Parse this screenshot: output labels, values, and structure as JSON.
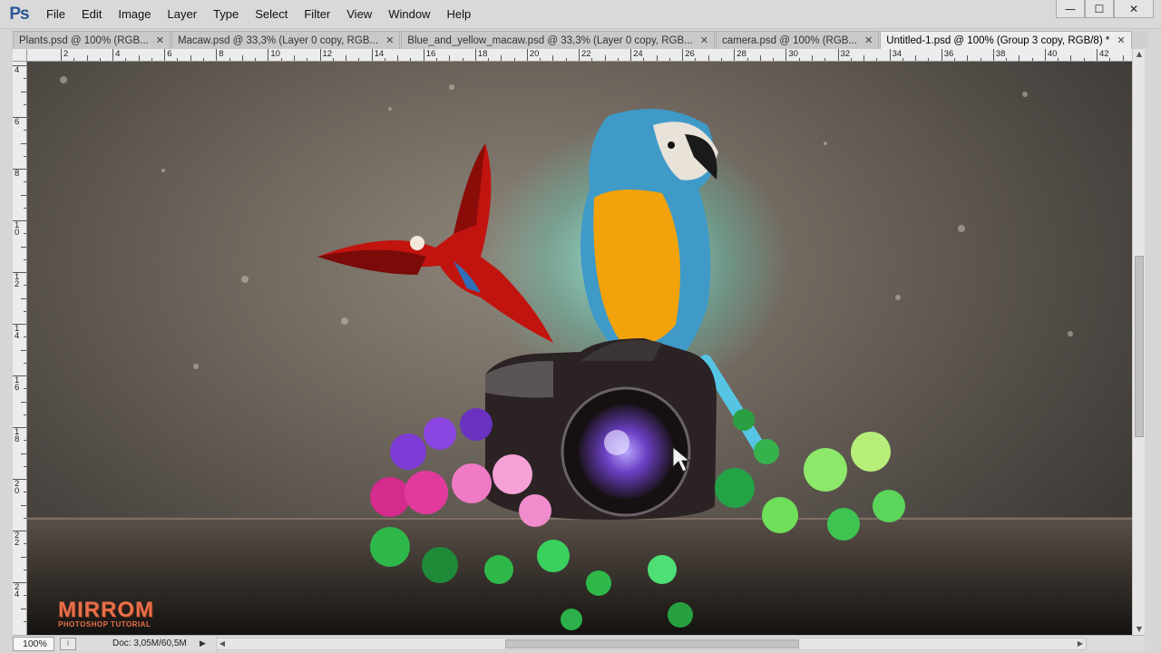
{
  "app": {
    "logo": "Ps"
  },
  "menu": [
    "File",
    "Edit",
    "Image",
    "Layer",
    "Type",
    "Select",
    "Filter",
    "View",
    "Window",
    "Help"
  ],
  "window_controls": {
    "minimize": "—",
    "maximize": "☐",
    "close": "✕"
  },
  "tabs": [
    {
      "label": "Plants.psd @ 100% (RGB...",
      "active": false
    },
    {
      "label": "Macaw.psd @ 33,3% (Layer 0 copy, RGB...",
      "active": false
    },
    {
      "label": "Blue_and_yellow_macaw.psd @ 33,3% (Layer 0 copy, RGB...",
      "active": false
    },
    {
      "label": "camera.psd @ 100% (RGB...",
      "active": false
    },
    {
      "label": "Untitled-1.psd @ 100% (Group 3 copy, RGB/8) *",
      "active": true
    }
  ],
  "tab_close_glyph": "✕",
  "ruler_h_labels": [
    "2",
    "4",
    "6",
    "8",
    "10",
    "12",
    "14",
    "16",
    "18",
    "20",
    "22",
    "24",
    "26",
    "28",
    "30",
    "32",
    "34",
    "36",
    "38",
    "40",
    "42"
  ],
  "ruler_v_labels": [
    "4",
    "6",
    "8",
    "10",
    "12",
    "14",
    "16",
    "18",
    "20",
    "22",
    "24"
  ],
  "canvas": {
    "watermark_title": "MIRROM",
    "watermark_subtitle": "PHOTOSHOP TUTORIAL"
  },
  "status": {
    "zoom": "100%",
    "doc": "Doc: 3,05M/60,5M",
    "arrow": "▶"
  },
  "icons": {
    "status": "info-icon",
    "scroll_up": "▲",
    "scroll_down": "▼",
    "scroll_left": "◀",
    "scroll_right": "▶"
  }
}
